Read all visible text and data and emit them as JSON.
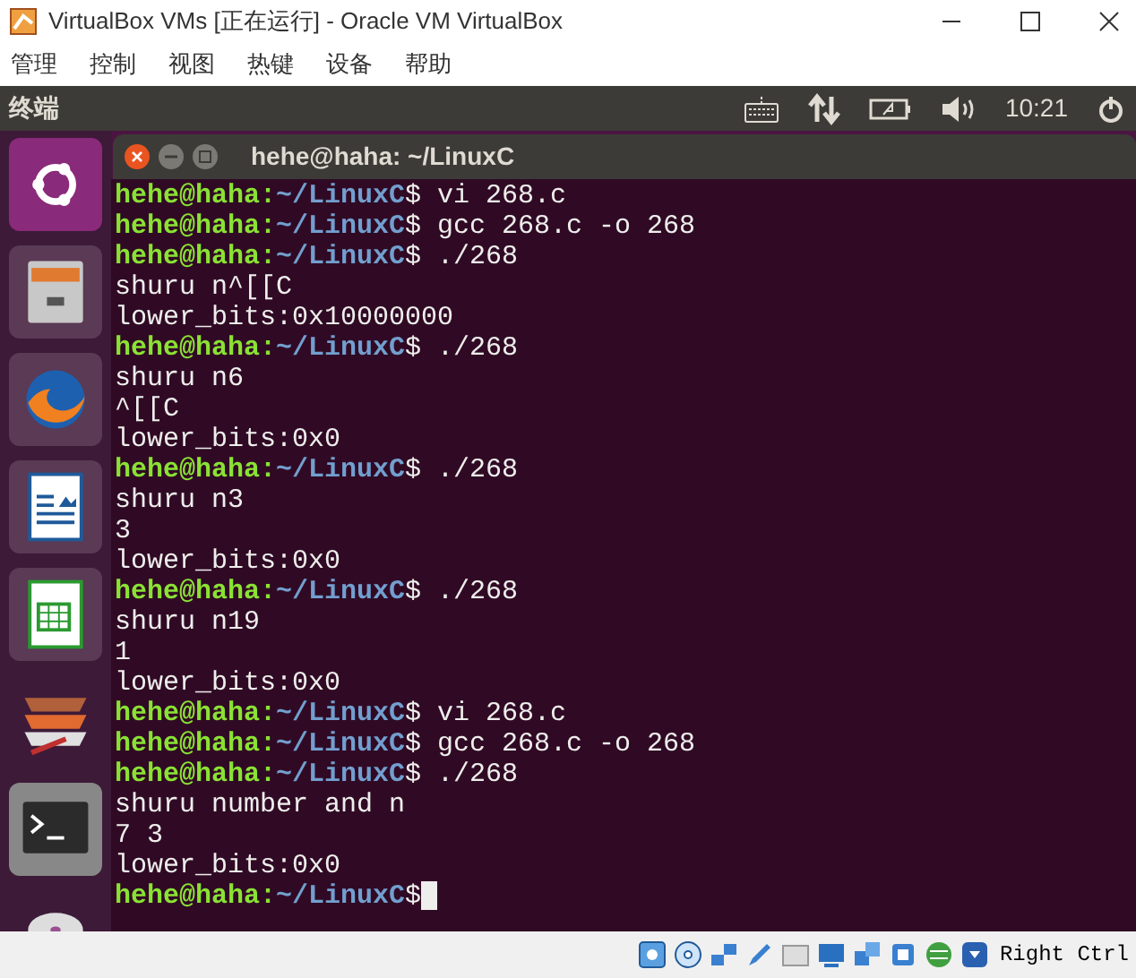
{
  "window": {
    "title": "VirtualBox VMs [正在运行] - Oracle VM VirtualBox"
  },
  "menu": [
    "管理",
    "控制",
    "视图",
    "热键",
    "设备",
    "帮助"
  ],
  "top_panel": {
    "app_name": "终端",
    "clock": "10:21"
  },
  "launcher": [
    {
      "kind": "ubuntu"
    },
    {
      "kind": "files"
    },
    {
      "kind": "firefox"
    },
    {
      "kind": "writer"
    },
    {
      "kind": "calc"
    },
    {
      "kind": "stack"
    },
    {
      "kind": "terminal"
    },
    {
      "kind": "disc"
    }
  ],
  "terminal": {
    "title": "hehe@haha: ~/LinuxC",
    "lines": [
      {
        "kind": "prompt",
        "user": "hehe@haha:",
        "path": "~/LinuxC",
        "command": "$ vi 268.c"
      },
      {
        "kind": "prompt",
        "user": "hehe@haha:",
        "path": "~/LinuxC",
        "command": "$ gcc 268.c -o 268"
      },
      {
        "kind": "prompt",
        "user": "hehe@haha:",
        "path": "~/LinuxC",
        "command": "$ ./268"
      },
      {
        "kind": "output",
        "text": "shuru n^[[C"
      },
      {
        "kind": "output",
        "text": "lower_bits:0x10000000"
      },
      {
        "kind": "prompt",
        "user": "hehe@haha:",
        "path": "~/LinuxC",
        "command": "$ ./268"
      },
      {
        "kind": "output",
        "text": "shuru n6"
      },
      {
        "kind": "output",
        "text": "^[[C"
      },
      {
        "kind": "output",
        "text": "lower_bits:0x0"
      },
      {
        "kind": "prompt",
        "user": "hehe@haha:",
        "path": "~/LinuxC",
        "command": "$ ./268"
      },
      {
        "kind": "output",
        "text": "shuru n3"
      },
      {
        "kind": "output",
        "text": "3"
      },
      {
        "kind": "output",
        "text": "lower_bits:0x0"
      },
      {
        "kind": "prompt",
        "user": "hehe@haha:",
        "path": "~/LinuxC",
        "command": "$ ./268"
      },
      {
        "kind": "output",
        "text": "shuru n19"
      },
      {
        "kind": "output",
        "text": "1"
      },
      {
        "kind": "output",
        "text": "lower_bits:0x0"
      },
      {
        "kind": "prompt",
        "user": "hehe@haha:",
        "path": "~/LinuxC",
        "command": "$ vi 268.c"
      },
      {
        "kind": "prompt",
        "user": "hehe@haha:",
        "path": "~/LinuxC",
        "command": "$ gcc 268.c -o 268"
      },
      {
        "kind": "prompt",
        "user": "hehe@haha:",
        "path": "~/LinuxC",
        "command": "$ ./268"
      },
      {
        "kind": "output",
        "text": "shuru number and n"
      },
      {
        "kind": "output",
        "text": "7 3"
      },
      {
        "kind": "output",
        "text": "lower_bits:0x0"
      },
      {
        "kind": "prompt",
        "user": "hehe@haha:",
        "path": "~/LinuxC",
        "command": "$"
      }
    ]
  },
  "status_bar": {
    "host_key": "Right Ctrl"
  }
}
